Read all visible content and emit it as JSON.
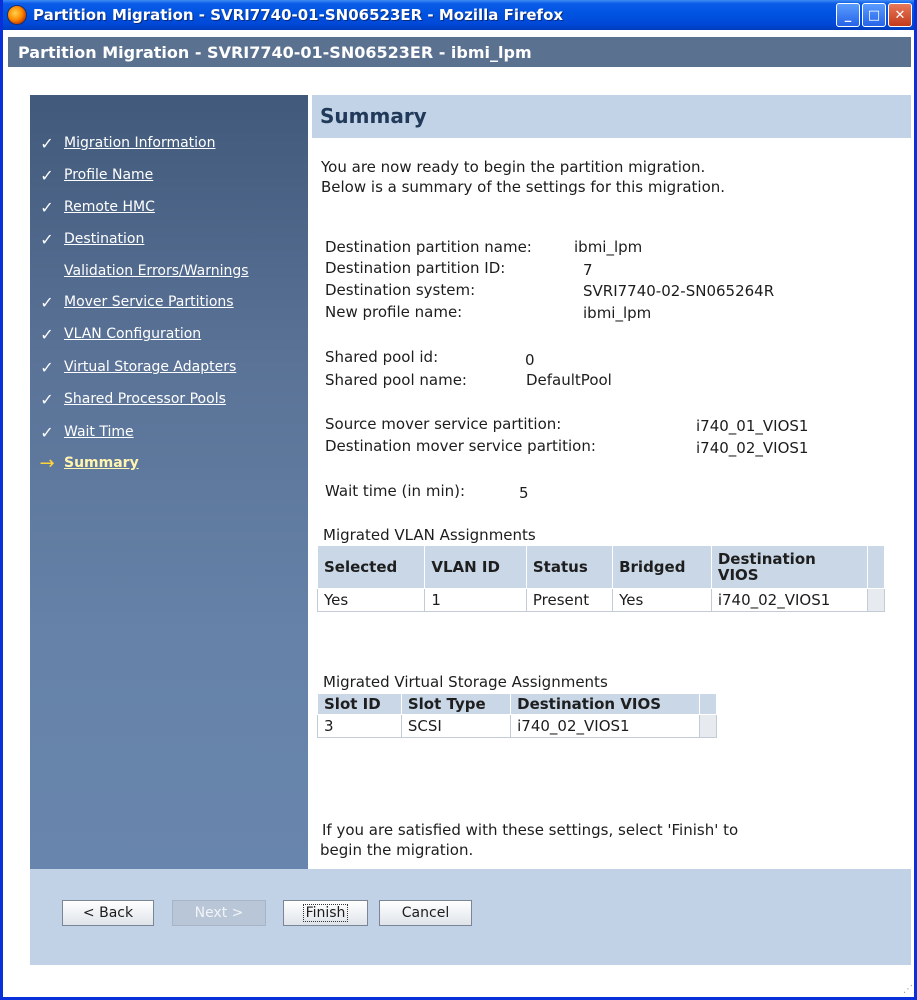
{
  "window": {
    "title": "Partition Migration - SVRI7740-01-SN06523ER - Mozilla Firefox",
    "controls": {
      "minimize": "_",
      "maximize": "□",
      "close": "✕"
    }
  },
  "header": {
    "title": "Partition Migration - SVRI7740-01-SN06523ER - ibmi_lpm"
  },
  "nav": {
    "items": [
      {
        "label": "Migration Information",
        "state": "done",
        "mark": "✓"
      },
      {
        "label": "Profile Name",
        "state": "done",
        "mark": "✓"
      },
      {
        "label": "Remote HMC",
        "state": "done",
        "mark": "✓"
      },
      {
        "label": "Destination",
        "state": "done",
        "mark": "✓"
      },
      {
        "label": "Validation Errors/Warnings",
        "state": "none",
        "mark": ""
      },
      {
        "label": "Mover Service Partitions",
        "state": "done",
        "mark": "✓"
      },
      {
        "label": "VLAN Configuration",
        "state": "done",
        "mark": "✓"
      },
      {
        "label": "Virtual Storage Adapters",
        "state": "done",
        "mark": "✓"
      },
      {
        "label": "Shared Processor Pools",
        "state": "done",
        "mark": "✓"
      },
      {
        "label": "Wait Time",
        "state": "done",
        "mark": "✓"
      },
      {
        "label": "Summary",
        "state": "current",
        "mark": "→"
      }
    ]
  },
  "summary": {
    "title": "Summary",
    "intro_line1": "You are now ready to begin the partition migration.",
    "intro_line2": "Below is a summary of the settings for this migration.",
    "dest_partition_name_label": "Destination partition name:",
    "dest_partition_name": "ibmi_lpm",
    "dest_partition_id_label": "Destination partition ID:",
    "dest_partition_id": "7",
    "dest_system_label": "Destination system:",
    "dest_system": "SVRI7740-02-SN065264R",
    "new_profile_label": "New profile name:",
    "new_profile": "ibmi_lpm",
    "shared_pool_id_label": "Shared pool id:",
    "shared_pool_id": "0",
    "shared_pool_name_label": "Shared pool name:",
    "shared_pool_name": "DefaultPool",
    "source_msp_label": "Source mover service partition:",
    "source_msp": "i740_01_VIOS1",
    "dest_msp_label": "Destination mover service partition:",
    "dest_msp": "i740_02_VIOS1",
    "wait_time_label": "Wait time (in min):",
    "wait_time": "5",
    "closing_line1": "If you are satisfied with these settings, select 'Finish' to",
    "closing_line2": "begin the migration."
  },
  "vlan": {
    "title": "Migrated VLAN Assignments",
    "headers": {
      "selected": "Selected",
      "vlan_id": "VLAN ID",
      "status": "Status",
      "bridged": "Bridged",
      "dest_vios_1": "Destination",
      "dest_vios_2": "VIOS"
    },
    "rows": [
      {
        "selected": "Yes",
        "vlan_id": "1",
        "status": "Present",
        "bridged": "Yes",
        "dest_vios": "i740_02_VIOS1"
      }
    ]
  },
  "storage": {
    "title": "Migrated Virtual Storage Assignments",
    "headers": {
      "slot_id": "Slot ID",
      "slot_type": "Slot Type",
      "dest_vios": "Destination VIOS"
    },
    "rows": [
      {
        "slot_id": "3",
        "slot_type": "SCSI",
        "dest_vios": "i740_02_VIOS1"
      }
    ]
  },
  "buttons": {
    "back": "< Back",
    "next": "Next >",
    "finish": "Finish",
    "cancel": "Cancel"
  }
}
